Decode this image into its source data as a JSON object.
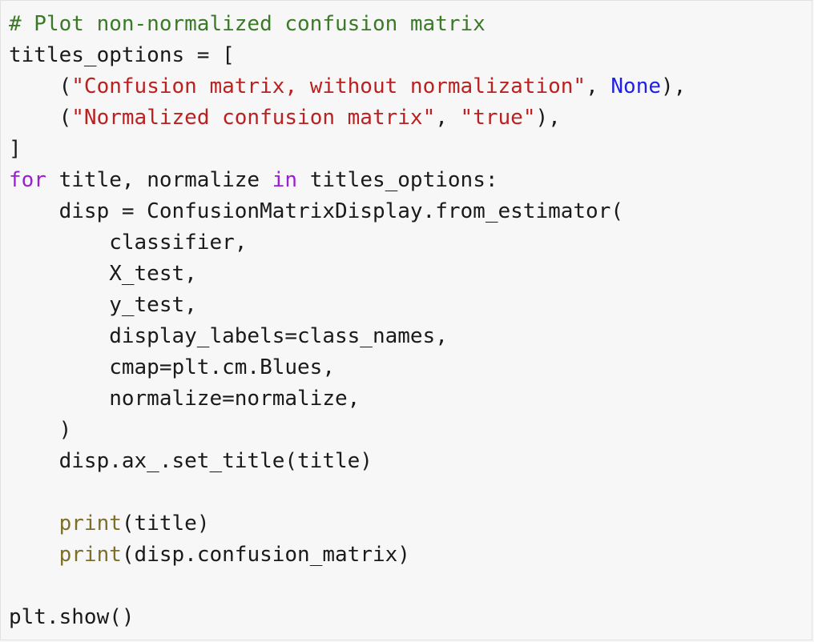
{
  "colors": {
    "background": "#f7f7f7",
    "comment": "#3a7a27",
    "string": "#ba2121",
    "keyword": "#9b1fd1",
    "constant": "#1f1fe6",
    "builtin": "#7d6f28",
    "text": "#1a1a1a"
  },
  "code": {
    "lines": [
      [
        {
          "t": "# Plot non-normalized confusion matrix",
          "k": "comment"
        }
      ],
      [
        {
          "t": "titles_options = [",
          "k": "plain"
        }
      ],
      [
        {
          "t": "    (",
          "k": "plain"
        },
        {
          "t": "\"Confusion matrix, without normalization\"",
          "k": "string"
        },
        {
          "t": ", ",
          "k": "plain"
        },
        {
          "t": "None",
          "k": "const"
        },
        {
          "t": "),",
          "k": "plain"
        }
      ],
      [
        {
          "t": "    (",
          "k": "plain"
        },
        {
          "t": "\"Normalized confusion matrix\"",
          "k": "string"
        },
        {
          "t": ", ",
          "k": "plain"
        },
        {
          "t": "\"true\"",
          "k": "string"
        },
        {
          "t": "),",
          "k": "plain"
        }
      ],
      [
        {
          "t": "]",
          "k": "plain"
        }
      ],
      [
        {
          "t": "for",
          "k": "keyword"
        },
        {
          "t": " title, normalize ",
          "k": "plain"
        },
        {
          "t": "in",
          "k": "keyword"
        },
        {
          "t": " titles_options:",
          "k": "plain"
        }
      ],
      [
        {
          "t": "    disp = ConfusionMatrixDisplay.from_estimator(",
          "k": "plain"
        }
      ],
      [
        {
          "t": "        classifier,",
          "k": "plain"
        }
      ],
      [
        {
          "t": "        X_test,",
          "k": "plain"
        }
      ],
      [
        {
          "t": "        y_test,",
          "k": "plain"
        }
      ],
      [
        {
          "t": "        display_labels=class_names,",
          "k": "plain"
        }
      ],
      [
        {
          "t": "        cmap=plt.cm.Blues,",
          "k": "plain"
        }
      ],
      [
        {
          "t": "        normalize=normalize,",
          "k": "plain"
        }
      ],
      [
        {
          "t": "    )",
          "k": "plain"
        }
      ],
      [
        {
          "t": "    disp.ax_.set_title(title)",
          "k": "plain"
        }
      ],
      [
        {
          "t": "",
          "k": "plain"
        }
      ],
      [
        {
          "t": "    ",
          "k": "plain"
        },
        {
          "t": "print",
          "k": "builtin"
        },
        {
          "t": "(title)",
          "k": "plain"
        }
      ],
      [
        {
          "t": "    ",
          "k": "plain"
        },
        {
          "t": "print",
          "k": "builtin"
        },
        {
          "t": "(disp.confusion_matrix)",
          "k": "plain"
        }
      ],
      [
        {
          "t": "",
          "k": "plain"
        }
      ],
      [
        {
          "t": "plt.show()",
          "k": "plain"
        }
      ]
    ]
  }
}
